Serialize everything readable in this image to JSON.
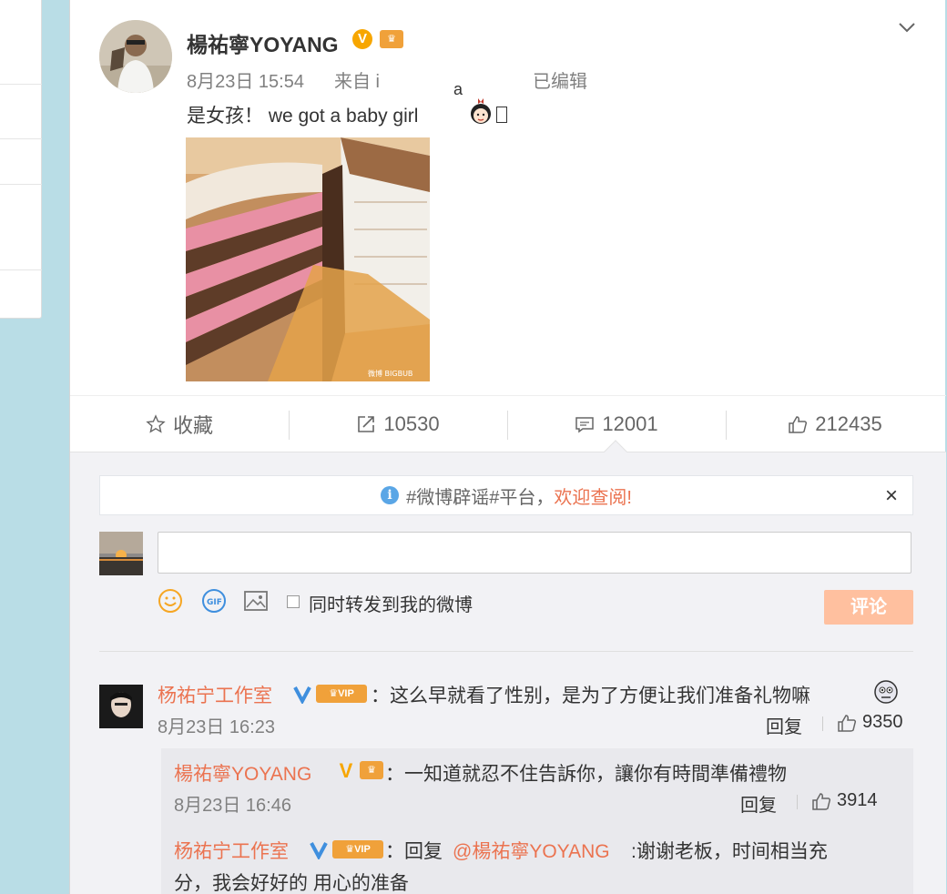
{
  "post": {
    "username": "楊祐寧YOYANG",
    "time": "8月23日 15:54",
    "source": "来自 i",
    "edited": "已编辑",
    "text": "是女孩！  we got a baby girl",
    "float_char": "a",
    "image_watermark": "微博 BIGBUB"
  },
  "actions": {
    "favorite": "收藏",
    "repost_count": "10530",
    "comment_count": "12001",
    "like_count": "212435"
  },
  "notice": {
    "prefix": "#微博辟谣#平台，",
    "highlight": "欢迎查阅!",
    "close": "×"
  },
  "composer": {
    "input_value": "",
    "forward_label": "同时转发到我的微博",
    "submit_label": "评论"
  },
  "comments": [
    {
      "name": "杨祐宁工作室",
      "text": "：这么早就看了性别，是为了方便让我们准备礼物嘛",
      "time": "8月23日 16:23",
      "reply_label": "回复",
      "likes": "9350"
    }
  ],
  "replies": [
    {
      "name": "楊祐寧YOYANG",
      "text": "：一知道就忍不住告訴你，讓你有時間準備禮物",
      "time": "8月23日 16:46",
      "reply_label": "回复",
      "likes": "3914"
    },
    {
      "name": "杨祐宁工作室",
      "text_prefix": "：回复",
      "mention": "@楊祐寧YOYANG",
      "text": ":谢谢老板，时间相当充",
      "text_line2": "分，我会好好的 用心的准备"
    }
  ],
  "colors": {
    "link_orange": "#eb7350",
    "verified_gold": "#f7a600",
    "verified_blue": "#3f8fde",
    "submit_bg": "#ffc09f"
  }
}
